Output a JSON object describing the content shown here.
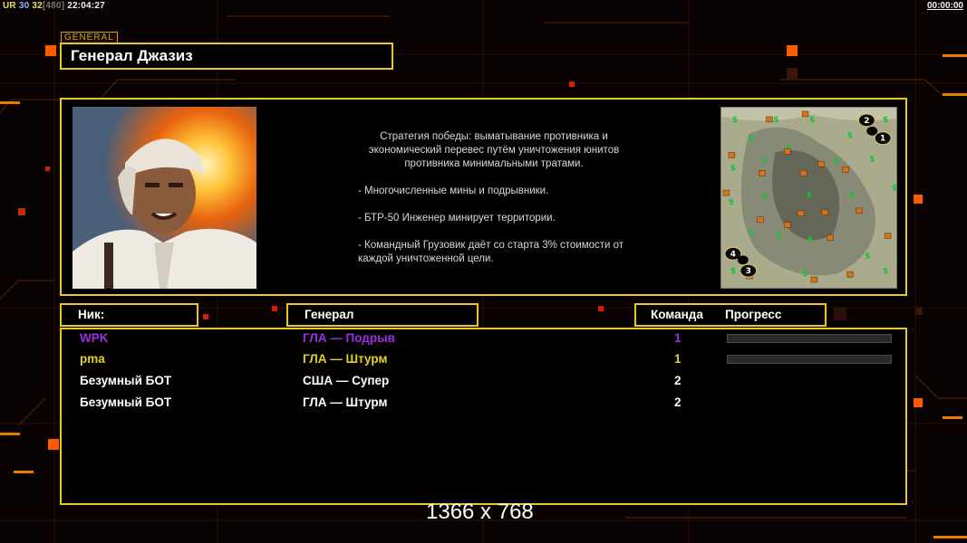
{
  "hud": {
    "left_prefix": "UR",
    "left_num1": "30",
    "left_num2": "32",
    "left_num3": "[480]",
    "left_clock": "22:04:27",
    "right_clock": "00:00:00"
  },
  "general_tag": "GENERAL",
  "general_name": "Генерал Джазиз",
  "description": {
    "strategy": "Стратегия победы: выматывание противника и экономический перевес путём уничтожения юнитов противника минимальными тратами.",
    "bullet1": "- Многочисленные мины и подрывники.",
    "bullet2": "- БТР-50 Инженер минирует территории.",
    "bullet3": "- Командный Грузовик даёт со старта 3% стоимости от каждой уничтоженной цели."
  },
  "minimap": {
    "start_positions": [
      "1",
      "2",
      "3",
      "4"
    ]
  },
  "headers": {
    "nick": "Ник:",
    "general": "Генерал",
    "team": "Команда",
    "progress": "Прогресс"
  },
  "players": [
    {
      "nick": "WPK",
      "general": "ГЛА — Подрыв",
      "team": "1",
      "color": "#9b2ee0",
      "progress": 0
    },
    {
      "nick": "pma",
      "general": "ГЛА — Штурм",
      "team": "1",
      "color": "#e2d21c",
      "progress": 0
    },
    {
      "nick": "Безумный БОТ",
      "general": "США — Супер",
      "team": "2",
      "color": "#ffffff"
    },
    {
      "nick": "Безумный БОТ",
      "general": "ГЛА — Штурм",
      "team": "2",
      "color": "#ffffff"
    }
  ],
  "resolution_label": "1366 x 768",
  "colors": {
    "frame": "#e8c825",
    "accent_orange": "#ff6a00"
  }
}
